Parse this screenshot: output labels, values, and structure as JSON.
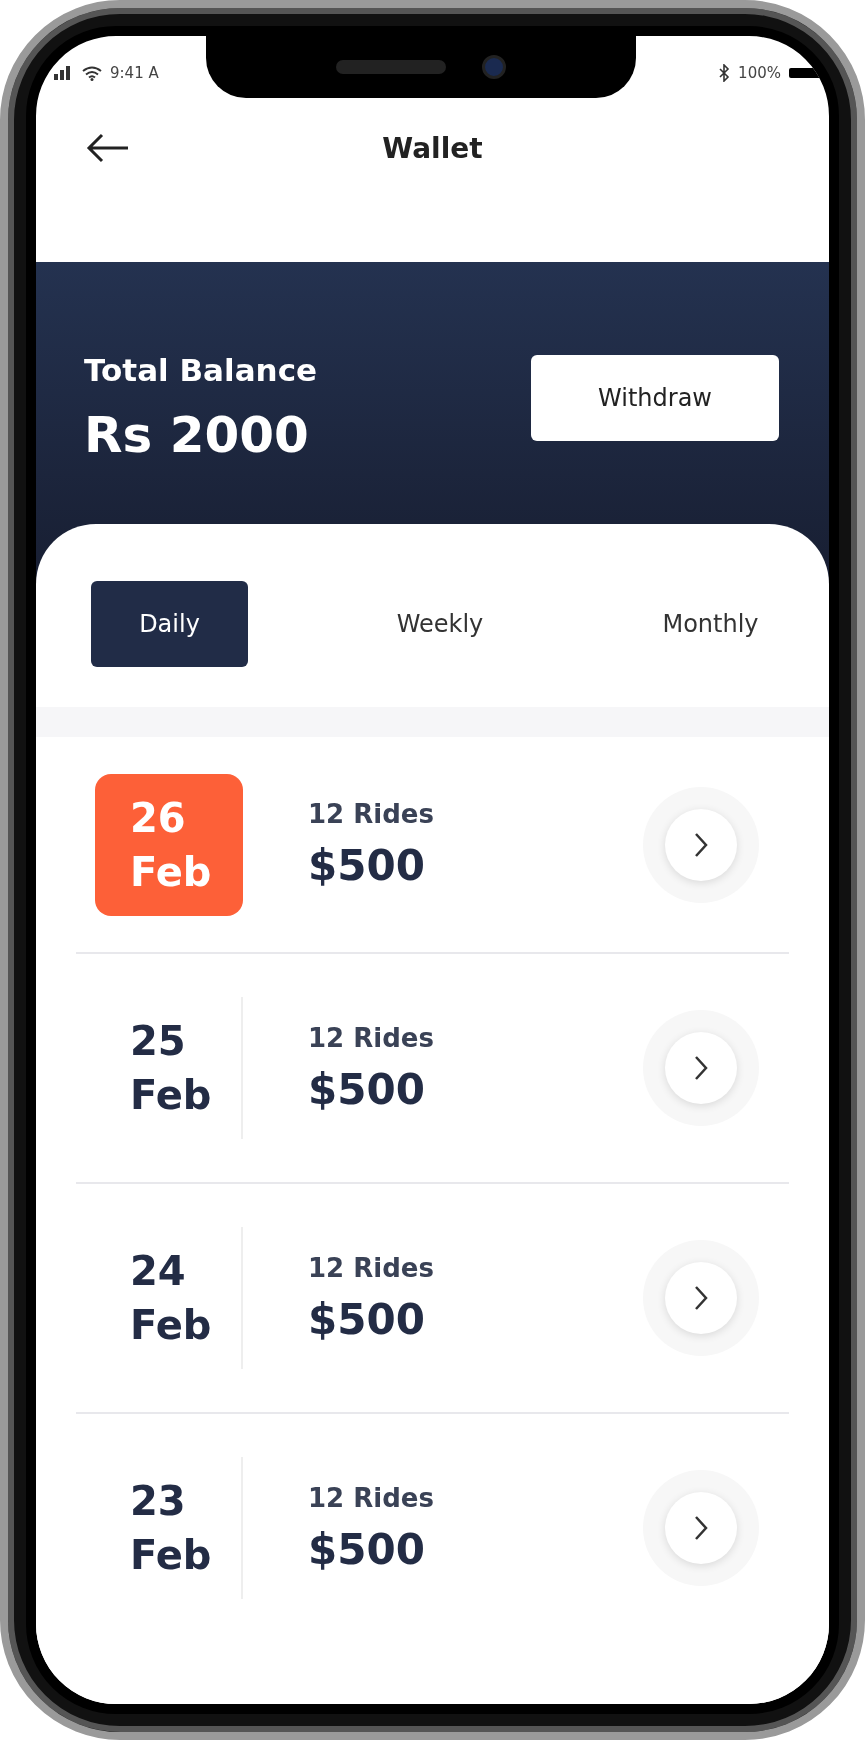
{
  "status_bar": {
    "time": "9:41 A",
    "battery": "100%"
  },
  "header": {
    "title": "Wallet"
  },
  "balance": {
    "label": "Total Balance",
    "amount": "Rs 2000",
    "button": "Withdraw"
  },
  "tabs": [
    {
      "label": "Daily",
      "selected": true
    },
    {
      "label": "Weekly",
      "selected": false
    },
    {
      "label": "Monthly",
      "selected": false
    }
  ],
  "rows": [
    {
      "day": "26",
      "month": "Feb",
      "rides": "12 Rides",
      "amount": "$500",
      "selected": true
    },
    {
      "day": "25",
      "month": "Feb",
      "rides": "12 Rides",
      "amount": "$500",
      "selected": false
    },
    {
      "day": "24",
      "month": "Feb",
      "rides": "12 Rides",
      "amount": "$500",
      "selected": false
    },
    {
      "day": "23",
      "month": "Feb",
      "rides": "12 Rides",
      "amount": "$500",
      "selected": false
    }
  ]
}
